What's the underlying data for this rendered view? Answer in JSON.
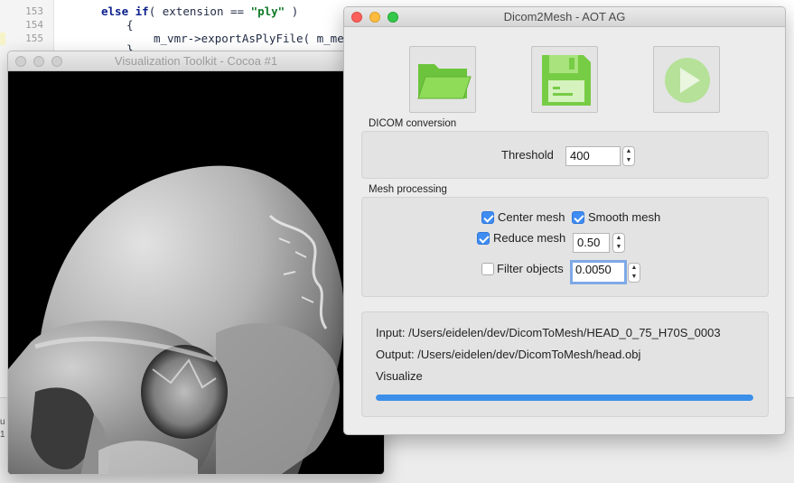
{
  "editor": {
    "line_numbers": [
      "153",
      "154",
      "155"
    ],
    "code": {
      "line1_kw1": "else if",
      "line1_mid": "( extension == ",
      "line1_str": "\"ply\"",
      "line1_end": " )",
      "line2": "{",
      "line3": "m_vmr->exportAsPlyFile( m_mesh",
      "line4": "}"
    },
    "left_marker_1": "u",
    "left_marker_2": "1"
  },
  "vtk_window": {
    "title": "Visualization Toolkit - Cocoa #1"
  },
  "dicom_window": {
    "title": "Dicom2Mesh - AOT AG",
    "toolbar": {
      "open_icon": "folder-icon",
      "save_icon": "floppy-disk-icon",
      "run_icon": "play-icon",
      "run_enabled": false,
      "accent_color": "#7fcf4f"
    },
    "dicom_conversion": {
      "group_label": "DICOM conversion",
      "threshold_label": "Threshold",
      "threshold_value": "400"
    },
    "mesh_processing": {
      "group_label": "Mesh processing",
      "center_mesh_label": "Center mesh",
      "center_mesh_checked": true,
      "smooth_mesh_label": "Smooth mesh",
      "smooth_mesh_checked": true,
      "reduce_mesh_label": "Reduce mesh",
      "reduce_mesh_checked": true,
      "reduce_mesh_value": "0.50",
      "filter_objects_label": "Filter objects",
      "filter_objects_checked": false,
      "filter_objects_value": "0.0050"
    },
    "status": {
      "input": "Input: /Users/eidelen/dev/DicomToMesh/HEAD_0_75_H70S_0003",
      "output": "Output: /Users/eidelen/dev/DicomToMesh/head.obj",
      "step": "Visualize",
      "progress": 1.0,
      "progress_color": "#3b8fe9"
    }
  }
}
